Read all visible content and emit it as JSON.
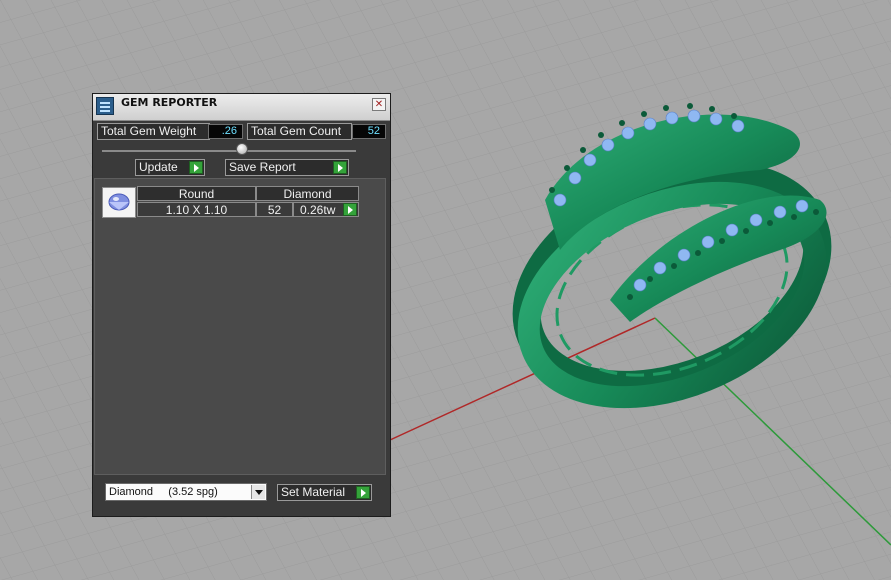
{
  "window": {
    "title": "GEM REPORTER"
  },
  "stats": {
    "weight_label": "Total Gem Weight",
    "weight_value": ".26",
    "count_label": "Total Gem Count",
    "count_value": "52"
  },
  "actions": {
    "update_label": "Update",
    "save_label": "Save Report"
  },
  "gem_list": {
    "headers": {
      "shape": "Round",
      "material": "Diamond"
    },
    "rows": [
      {
        "size": "1.10 X 1.10",
        "count": "52",
        "weight": "0.26tw"
      }
    ]
  },
  "footer": {
    "material_selected": "Diamond     (3.52 spg)",
    "set_material_label": "Set Material"
  },
  "colors": {
    "accent_green": "#34a33a",
    "readout_cyan": "#6ee0ff",
    "model_green": "#1c8a5c",
    "gem_blue": "#8fb8f2"
  }
}
